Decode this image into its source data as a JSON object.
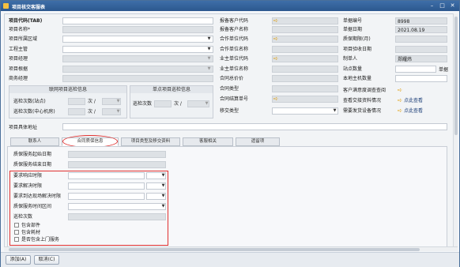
{
  "window": {
    "title": "项目核交客服表"
  },
  "left": {
    "rows": [
      {
        "label": "项目代码(TAB)",
        "bold": true
      },
      {
        "label": "项目名称*"
      },
      {
        "label": "项目所属区域"
      },
      {
        "label": "工程主管"
      },
      {
        "label": "项目经理"
      },
      {
        "label": "项目根据"
      },
      {
        "label": "商务经理"
      }
    ]
  },
  "groups": {
    "network": {
      "title": "联网项目巡检信息",
      "rows": [
        {
          "label": "巡检次数(站点)",
          "unit": "次 /"
        },
        {
          "label": "巡检次数(中心机房)",
          "unit": "次 /"
        }
      ]
    },
    "single": {
      "title": "单点项目巡检信息",
      "label": "巡检次数",
      "unit": "次 /"
    }
  },
  "middle": {
    "rows": [
      {
        "label": "报备客户代码"
      },
      {
        "label": "报备客户名称"
      },
      {
        "label": "合作单位代码"
      },
      {
        "label": "合作单位名称"
      },
      {
        "label": "业主单位代码"
      },
      {
        "label": "业主单位名称"
      },
      {
        "label": "合同总价价"
      },
      {
        "label": "合同类型"
      },
      {
        "label": "合同结算单号"
      },
      {
        "label": "移交类型"
      }
    ]
  },
  "right": {
    "rows": [
      {
        "label": "单据编号",
        "value": "8998"
      },
      {
        "label": "单据日期",
        "value": "2021.08.19"
      },
      {
        "label": "质保期限(月)",
        "value": ""
      },
      {
        "label": "项目验收日期",
        "value": ""
      },
      {
        "label": "制单人",
        "value": "郑耀炜"
      },
      {
        "label": "站点数量",
        "value": ""
      },
      {
        "label": "本地主机数量",
        "value": ""
      },
      {
        "label": "客户满意度调查查阅",
        "value": ""
      },
      {
        "label": "查看交接资料情况",
        "link": "点此查看"
      },
      {
        "label": "需要发货设备情况",
        "link": "点此查看"
      }
    ],
    "extra": "单据"
  },
  "address": {
    "label": "项目具体地址"
  },
  "tabs": [
    "联系人",
    "合同质保信息",
    "项目类型及移交资料",
    "客服相关",
    "遗留项"
  ],
  "active_tab": 1,
  "panel": {
    "fields": [
      {
        "label": "质保服务起始日期"
      },
      {
        "label": "质保服务结束日期"
      }
    ],
    "boxed": [
      {
        "label": "要求响应时限"
      },
      {
        "label": "要求解决时限"
      },
      {
        "label": "要求到达现场解决时限"
      },
      {
        "label": "质保服务时间区间"
      }
    ],
    "count_label": "巡检次数",
    "checks": [
      "包含部件",
      "包含耗材",
      "是否包含上门服务"
    ]
  },
  "buttons": {
    "add": "添加(A)",
    "cancel": "取消(C)"
  }
}
